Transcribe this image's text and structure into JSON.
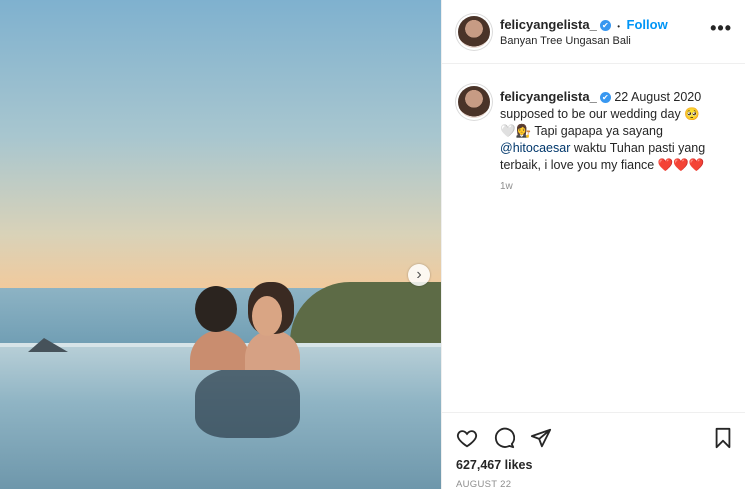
{
  "post": {
    "username": "felicyangelista_",
    "verified_mark": "✔",
    "follow_label": "Follow",
    "separator": "•",
    "location": "Banyan Tree Ungasan Bali",
    "more_label": "•••",
    "caption": {
      "date": "22 August 2020",
      "line1": "supposed to be our wedding day 🥺",
      "line2": "🤍👩‍⚖️ Tapi gapapa ya sayang",
      "mention": "@hitocaesar",
      "line3": " waktu Tuhan pasti yang",
      "line4": "terbaik, i love you my fiance ❤️❤️❤️"
    },
    "time_ago": "1w",
    "likes": "627,467 likes",
    "post_date": "AUGUST 22",
    "next_label": "›"
  },
  "icons": [
    "heart-icon",
    "comment-icon",
    "share-icon",
    "bookmark-icon",
    "chevron-right-icon",
    "more-icon"
  ]
}
